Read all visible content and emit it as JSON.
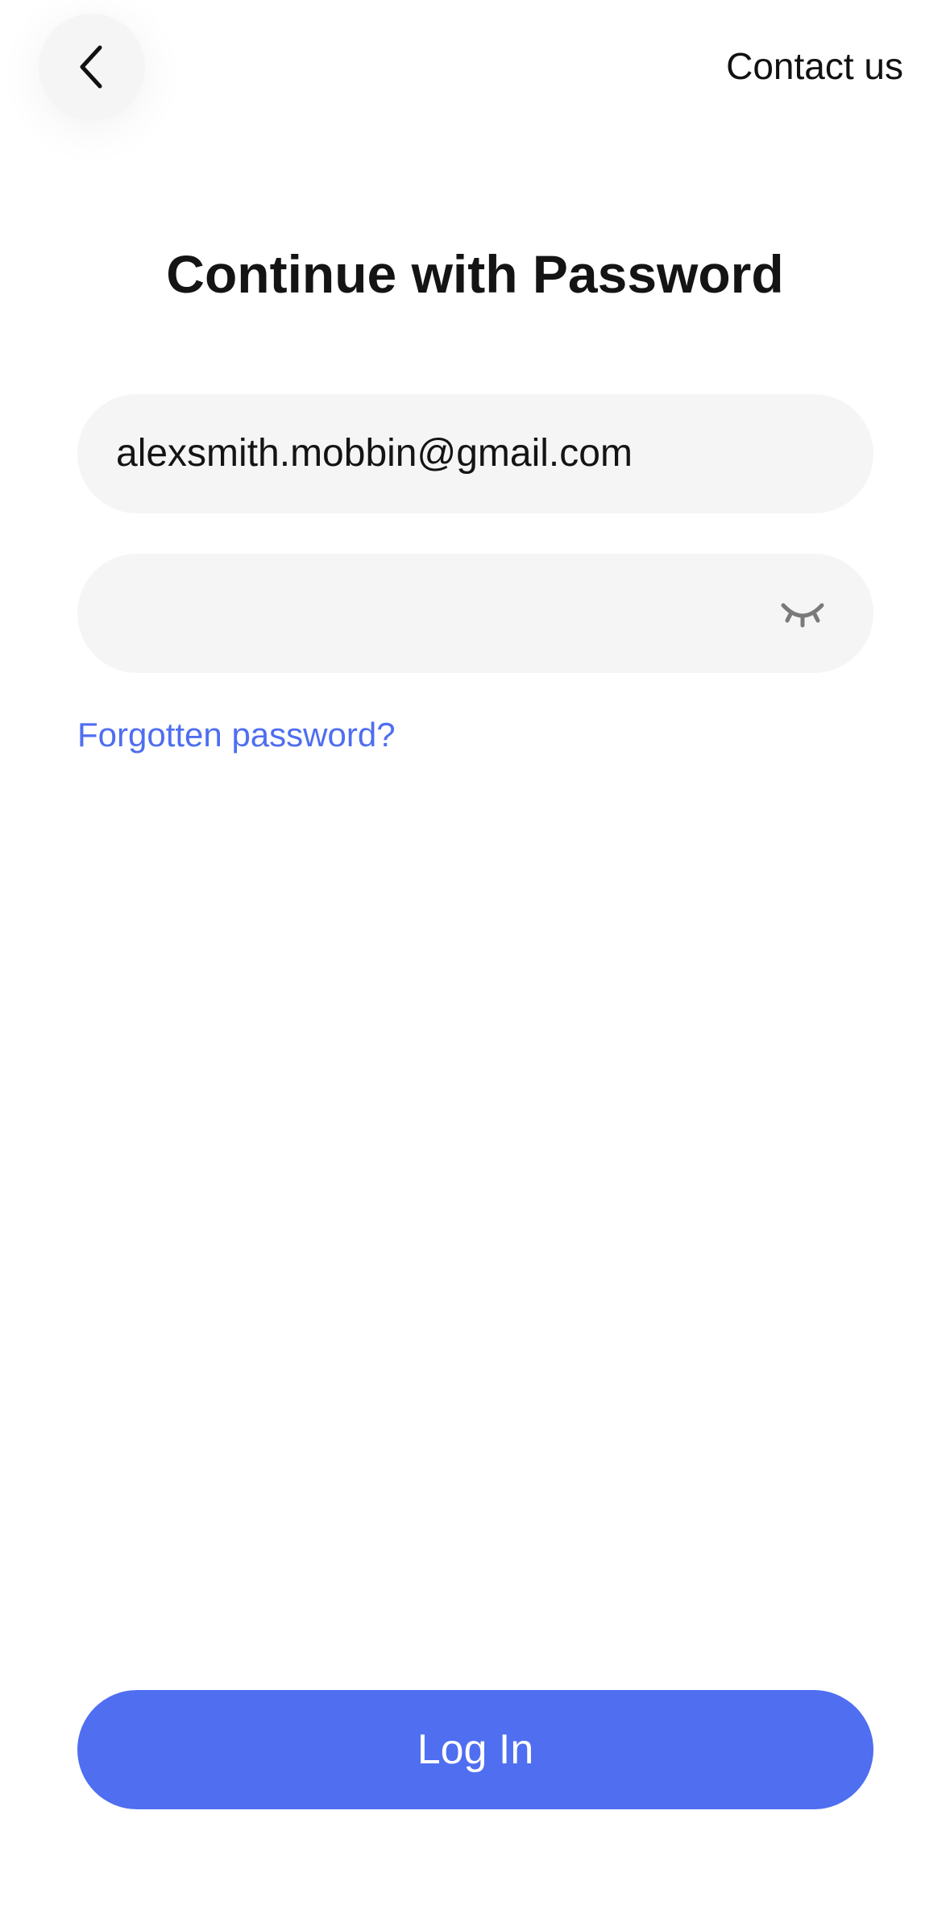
{
  "header": {
    "back_icon": "chevron-left-icon",
    "contact_label": "Contact us"
  },
  "main": {
    "title": "Continue with Password",
    "email_value": "alexsmith.mobbin@gmail.com",
    "password_value": "",
    "password_toggle_icon": "eye-closed-icon",
    "forgot_label": "Forgotten password?"
  },
  "footer": {
    "login_label": "Log In"
  },
  "colors": {
    "accent": "#4F6EF0",
    "field_background": "#F5F5F5",
    "text": "#141414"
  }
}
